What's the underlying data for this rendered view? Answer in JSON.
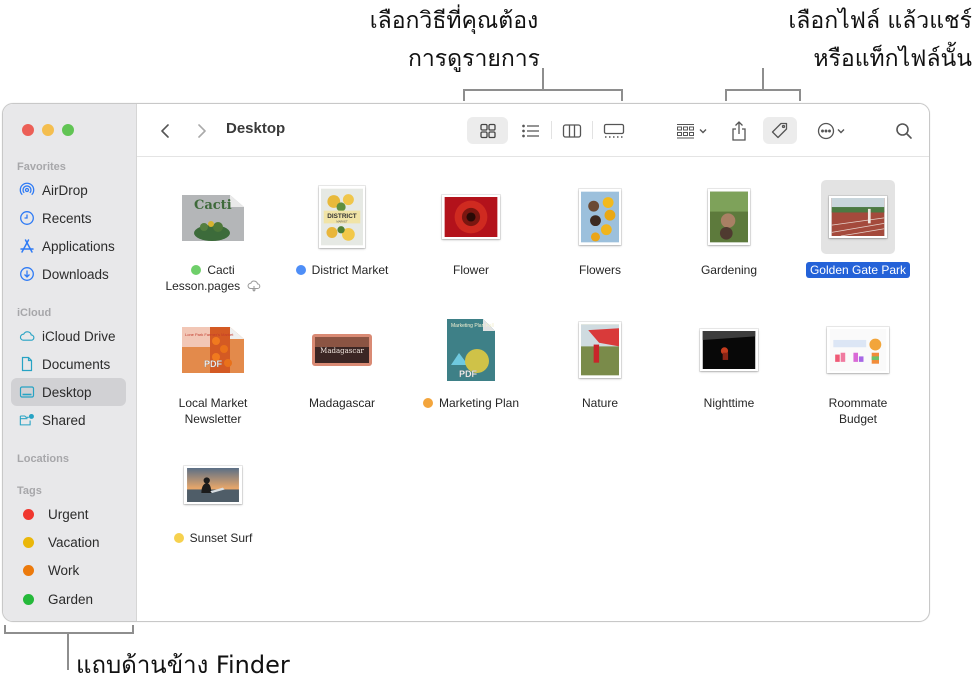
{
  "callouts": {
    "view_options": [
      "เลือกวิธีที่คุณต้อง",
      "การดูรายการ"
    ],
    "share_tag": [
      "เลือกไฟล์ แล้วแชร์",
      "หรือแท็กไฟล์นั้น"
    ],
    "sidebar": "แถบด้านข้าง Finder"
  },
  "window": {
    "title": "Desktop",
    "toolbar": {
      "back_icon": "chevron-left-icon",
      "forward_icon": "chevron-right-icon",
      "view_buttons": [
        {
          "icon": "icon-view-icon",
          "active": true
        },
        {
          "icon": "list-view-icon",
          "active": false
        },
        {
          "icon": "column-view-icon",
          "active": false
        },
        {
          "icon": "gallery-view-icon",
          "active": false
        }
      ],
      "group_icon": "group-by-icon",
      "share_icon": "share-icon",
      "tag_icon": "tag-icon",
      "more_icon": "more-actions-icon",
      "search_icon": "search-icon"
    }
  },
  "sidebar": {
    "sections": {
      "favorites": "Favorites",
      "icloud": "iCloud",
      "locations": "Locations",
      "tags": "Tags"
    },
    "favorites": [
      {
        "label": "AirDrop",
        "icon": "airdrop-icon"
      },
      {
        "label": "Recents",
        "icon": "clock-icon"
      },
      {
        "label": "Applications",
        "icon": "applications-icon"
      },
      {
        "label": "Downloads",
        "icon": "download-icon"
      }
    ],
    "icloud": [
      {
        "label": "iCloud Drive",
        "icon": "cloud-icon"
      },
      {
        "label": "Documents",
        "icon": "document-icon"
      },
      {
        "label": "Desktop",
        "icon": "desktop-icon",
        "selected": true
      },
      {
        "label": "Shared",
        "icon": "shared-folder-icon"
      }
    ],
    "tags": [
      {
        "label": "Urgent",
        "color": "#f0372f"
      },
      {
        "label": "Vacation",
        "color": "#eab70a"
      },
      {
        "label": "Work",
        "color": "#ec7a0c"
      },
      {
        "label": "Garden",
        "color": "#25b93a"
      }
    ]
  },
  "files": [
    {
      "name": "Cacti Lesson.pages",
      "line1": "Cacti",
      "line2": "Lesson.pages",
      "tag_color": "#6fcf6a",
      "cloud": true
    },
    {
      "name": "District Market",
      "tag_color": "#4e8ef7"
    },
    {
      "name": "Flower"
    },
    {
      "name": "Flowers"
    },
    {
      "name": "Gardening"
    },
    {
      "name": "Golden Gate Park",
      "selected": true
    },
    {
      "name": "Local Market Newsletter",
      "line1": "Local Market",
      "line2": "Newsletter"
    },
    {
      "name": "Madagascar"
    },
    {
      "name": "Marketing Plan",
      "tag_color": "#f3a53c"
    },
    {
      "name": "Nature"
    },
    {
      "name": "Nighttime"
    },
    {
      "name": "Roommate Budget",
      "line1": "Roommate",
      "line2": "Budget"
    },
    {
      "name": "Sunset Surf",
      "tag_color": "#f6d14e"
    }
  ],
  "thumbnails": {
    "cacti": {
      "title": "Cacti",
      "badge": ""
    },
    "district": {
      "title": "DISTRICT",
      "subtitle": "MARKET"
    },
    "newsletter": {
      "title": "Lone Park Farmer's Market",
      "badge": "PDF"
    },
    "madagascar": {
      "title": "Madagascar"
    },
    "marketing": {
      "title": "Marketing Plan Fall 2019",
      "badge": "PDF"
    }
  }
}
